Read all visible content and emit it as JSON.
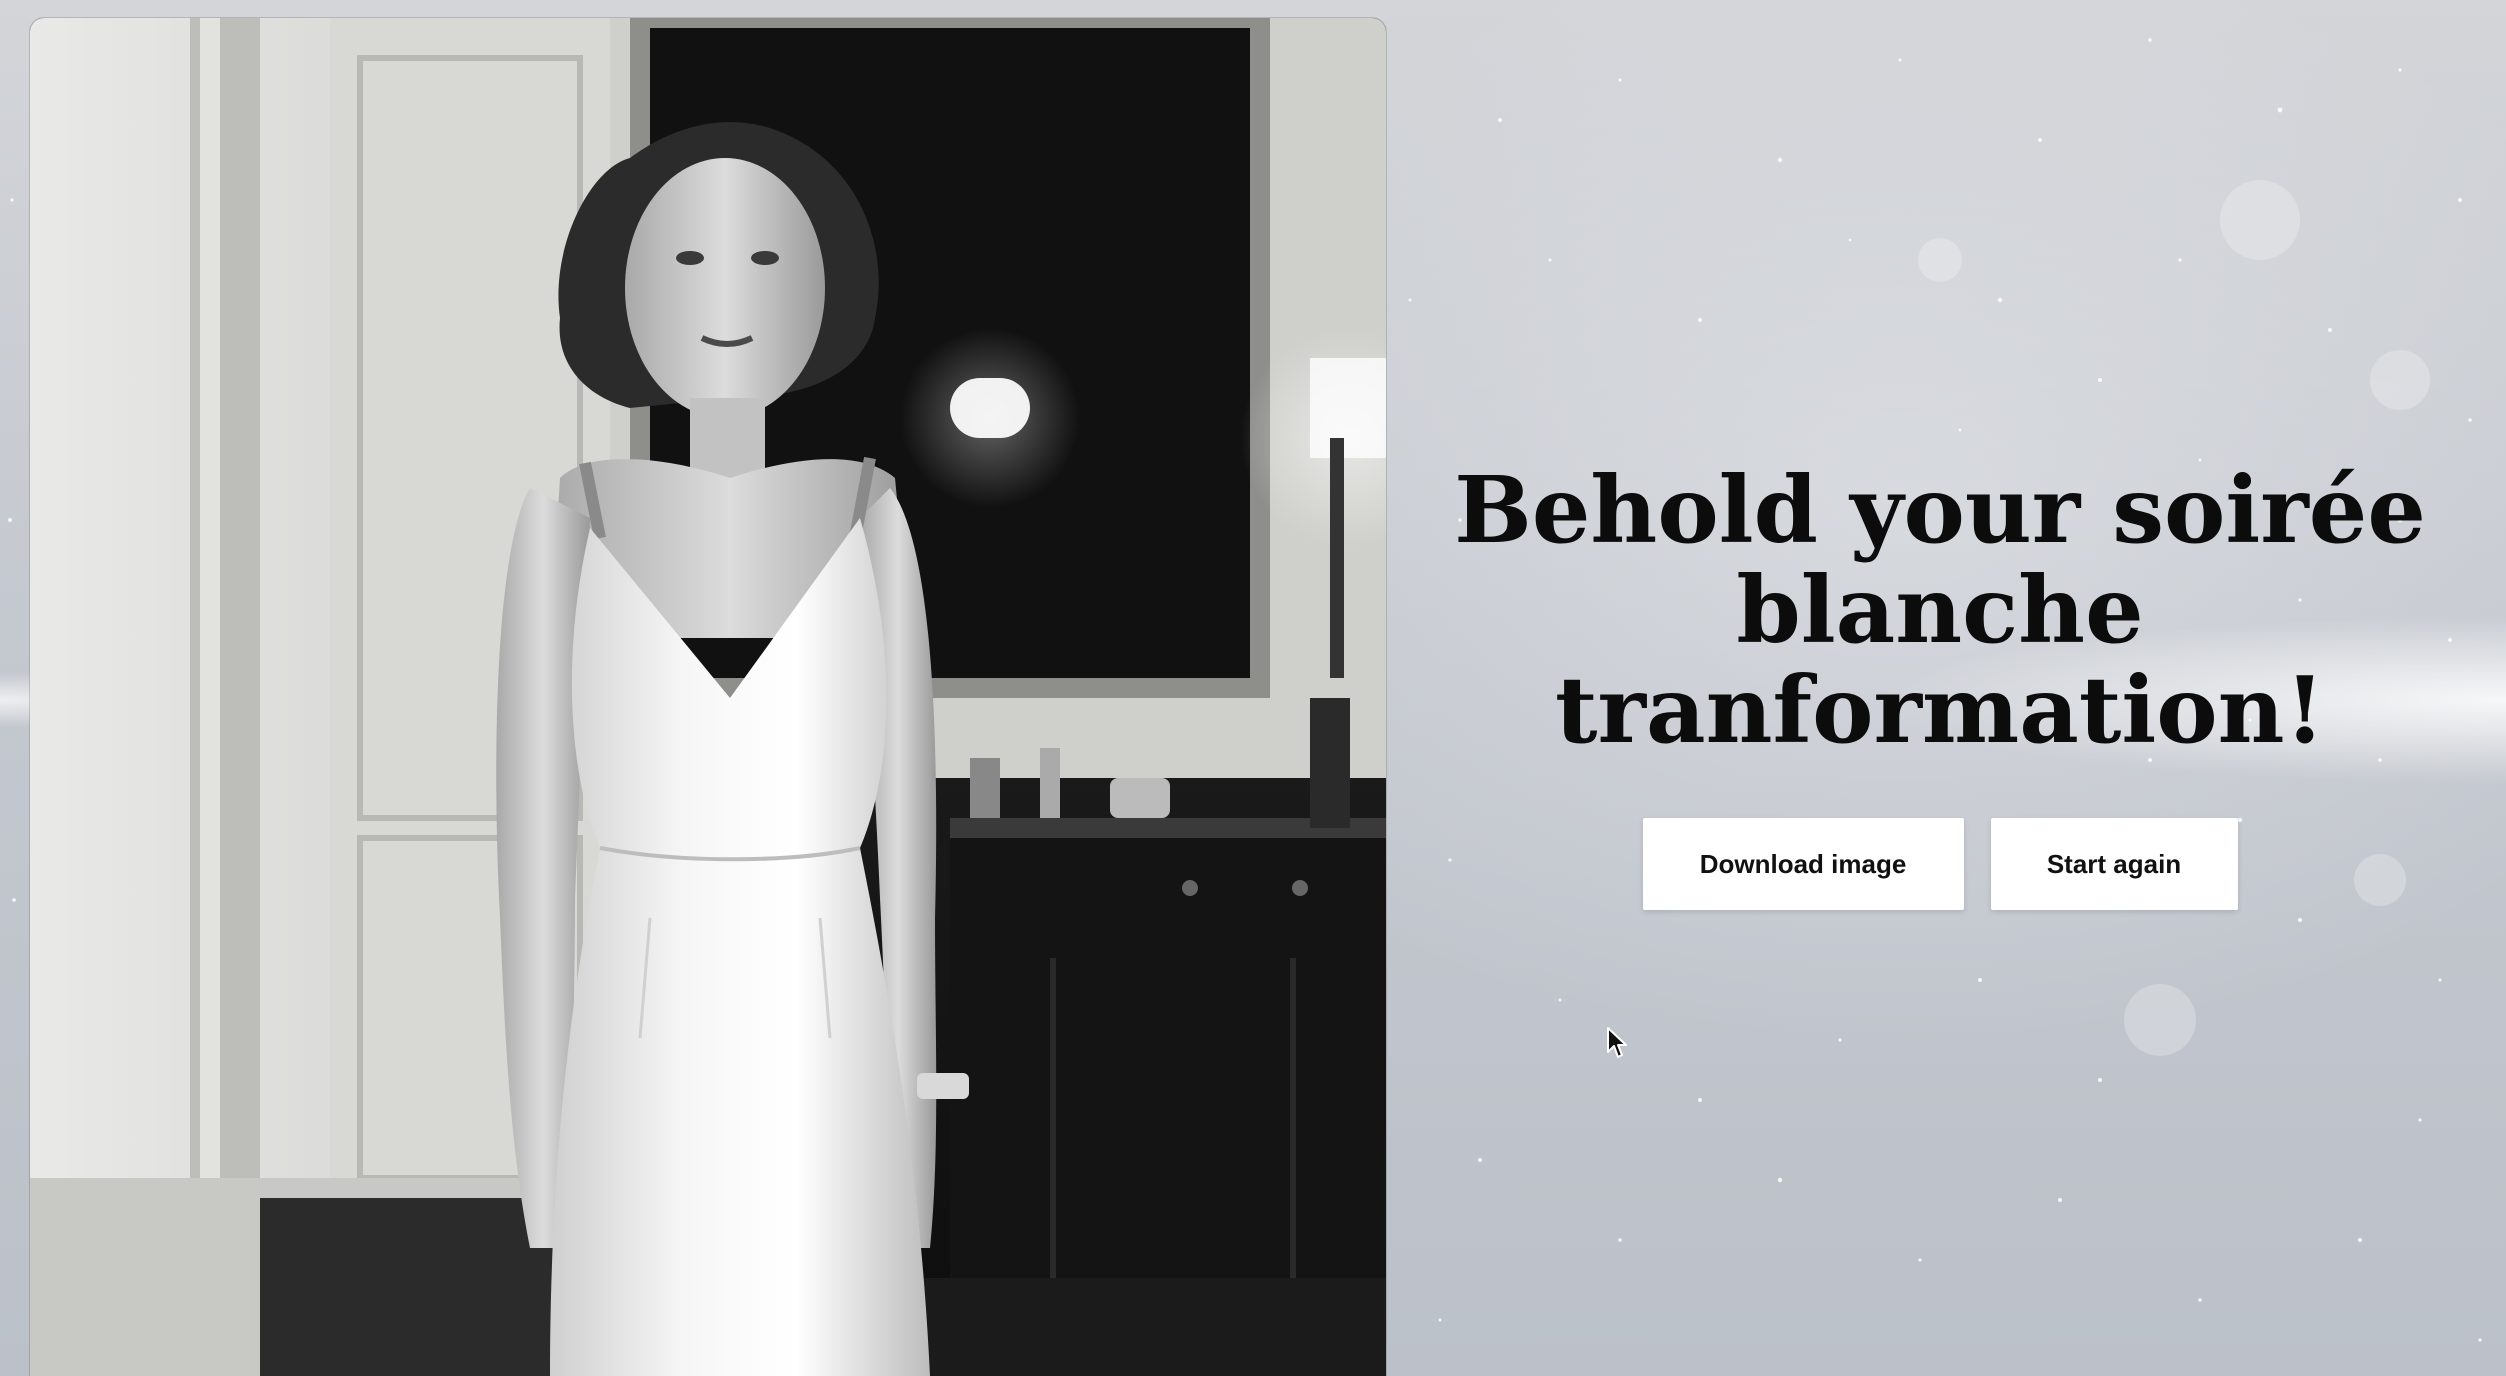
{
  "hero": {
    "title_line1": "Behold your soirée",
    "title_line2": "blanche",
    "title_line3": "tranformation!"
  },
  "actions": {
    "download_label": "Download image",
    "restart_label": "Start again"
  },
  "photo": {
    "description_icon": "generated-portrait-image",
    "tone": "black-and-white"
  },
  "colors": {
    "background": "#c4c8cf",
    "button_bg": "#ffffff",
    "title": "#0c0c0c"
  }
}
